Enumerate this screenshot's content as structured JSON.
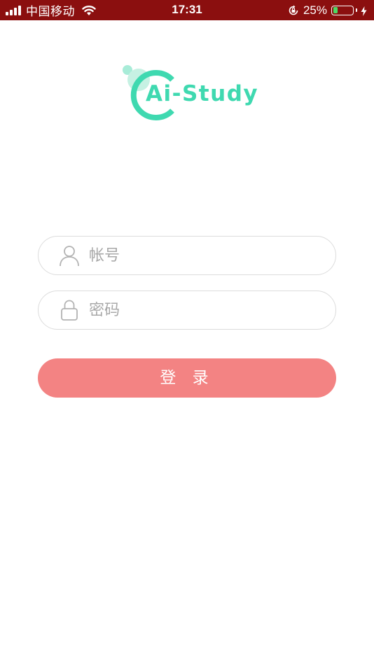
{
  "status_bar": {
    "carrier": "中国移动",
    "time": "17:31",
    "battery_percent": "25%",
    "battery_level": 0.25,
    "battery_color": "#4cd964",
    "background_color": "#8b0f0f",
    "icons": [
      "signal-icon",
      "wifi-icon",
      "orientation-lock-icon",
      "battery-icon",
      "charging-icon"
    ]
  },
  "logo": {
    "text": "Ai-Study",
    "color": "#3fd9b0"
  },
  "login_form": {
    "username": {
      "placeholder": "帐号",
      "value": "",
      "icon": "user-icon"
    },
    "password": {
      "placeholder": "密码",
      "value": "",
      "icon": "lock-icon"
    },
    "submit_label": "登 录",
    "submit_color": "#f38383"
  }
}
